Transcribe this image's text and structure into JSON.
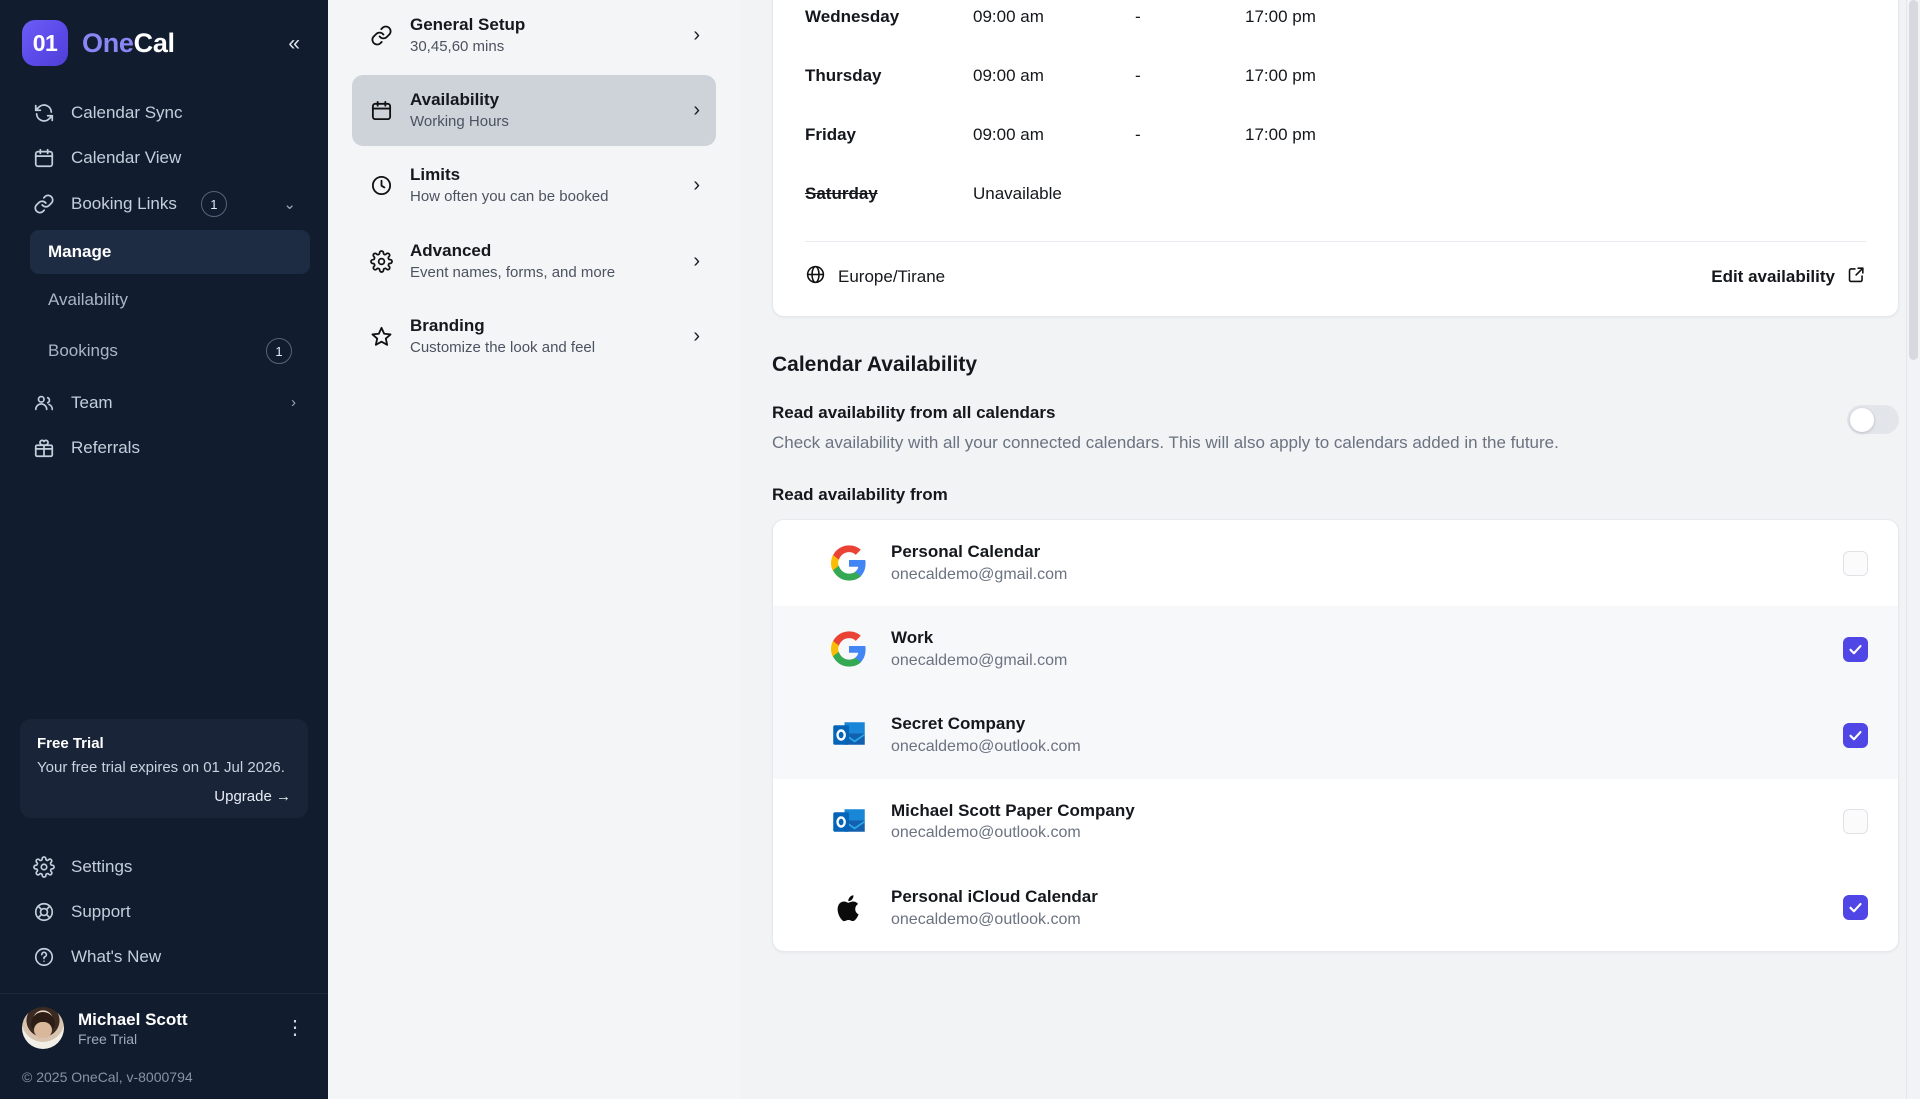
{
  "app": {
    "logo_mark": "01",
    "logo_one": "One",
    "logo_cal": "Cal",
    "collapse_icon": "«",
    "copyright": "© 2025 OneCal, v-8000794"
  },
  "sidebar": {
    "items": [
      {
        "label": "Calendar Sync",
        "icon": "sync-icon"
      },
      {
        "label": "Calendar View",
        "icon": "calendar-icon"
      },
      {
        "label": "Booking Links",
        "icon": "link-icon",
        "badge": "1",
        "chevron": "⌄"
      }
    ],
    "subitems": [
      {
        "label": "Manage",
        "active": true
      },
      {
        "label": "Availability",
        "active": false
      },
      {
        "label": "Bookings",
        "active": false,
        "badge": "1"
      }
    ],
    "items_after": [
      {
        "label": "Team",
        "icon": "team-icon",
        "chevron": "›"
      },
      {
        "label": "Referrals",
        "icon": "gift-icon"
      }
    ],
    "bottom_items": [
      {
        "label": "Settings",
        "icon": "gear-icon"
      },
      {
        "label": "Support",
        "icon": "lifebuoy-icon"
      },
      {
        "label": "What's New",
        "icon": "question-circle-icon"
      }
    ],
    "trial": {
      "title": "Free Trial",
      "description": "Your free trial expires on 01 Jul 2026.",
      "upgrade_label": "Upgrade →"
    },
    "profile": {
      "name": "Michael Scott",
      "plan": "Free Trial",
      "menu_icon": "⋮"
    }
  },
  "midpanel": {
    "items": [
      {
        "title": "General Setup",
        "subtitle": "30,45,60 mins",
        "icon": "link-icon",
        "active": false
      },
      {
        "title": "Availability",
        "subtitle": "Working Hours",
        "icon": "calendar-icon",
        "active": true
      },
      {
        "title": "Limits",
        "subtitle": "How often you can be booked",
        "icon": "clock-icon",
        "active": false
      },
      {
        "title": "Advanced",
        "subtitle": "Event names, forms, and more",
        "icon": "gear-icon",
        "active": false
      },
      {
        "title": "Branding",
        "subtitle": "Customize the look and feel",
        "icon": "star-icon",
        "active": false
      }
    ],
    "chevron": "›"
  },
  "schedule": {
    "rows": [
      {
        "day": "Wednesday",
        "start": "09:00 am",
        "dash": "-",
        "end": "17:00 pm",
        "unavailable": false
      },
      {
        "day": "Thursday",
        "start": "09:00 am",
        "dash": "-",
        "end": "17:00 pm",
        "unavailable": false
      },
      {
        "day": "Friday",
        "start": "09:00 am",
        "dash": "-",
        "end": "17:00 pm",
        "unavailable": false
      },
      {
        "day": "Saturday",
        "start": "Unavailable",
        "dash": "",
        "end": "",
        "unavailable": true
      }
    ],
    "timezone": "Europe/Tirane",
    "timezone_icon": "globe-icon",
    "edit_label": "Edit availability",
    "edit_icon": "external-link-icon"
  },
  "calendar_availability": {
    "section_title": "Calendar Availability",
    "toggle_label": "Read availability from all calendars",
    "toggle_description": "Check availability with all your connected calendars. This will also apply to calendars added in the future.",
    "toggle_on": false,
    "subsection_title": "Read availability from",
    "calendars": [
      {
        "name": "Personal Calendar",
        "email": "onecaldemo@gmail.com",
        "provider": "google",
        "checked": false
      },
      {
        "name": "Work",
        "email": "onecaldemo@gmail.com",
        "provider": "google",
        "checked": true
      },
      {
        "name": "Secret Company",
        "email": "onecaldemo@outlook.com",
        "provider": "outlook",
        "checked": true
      },
      {
        "name": "Michael Scott Paper Company",
        "email": "onecaldemo@outlook.com",
        "provider": "outlook",
        "checked": false
      },
      {
        "name": "Personal iCloud Calendar",
        "email": "onecaldemo@outlook.com",
        "provider": "apple",
        "checked": true
      }
    ]
  },
  "colors": {
    "sidebar_bg": "#111c2e",
    "accent": "#4f46e5",
    "brand_purple": "#6d5df6",
    "panel_bg": "#f4f5f7",
    "main_bg": "#f1f3f5"
  }
}
